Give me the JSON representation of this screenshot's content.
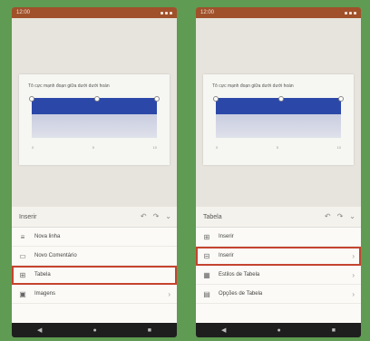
{
  "left_phone": {
    "slide_title": "Tô cực mạnh đoạn giữa dưới dưới hoàn",
    "axis": [
      "0",
      "5",
      "10"
    ],
    "panel_title": "Inserir",
    "menu_items": [
      {
        "label": "Nova linha",
        "icon": "text-icon",
        "chevron": false,
        "highlighted": false
      },
      {
        "label": "Novo Comentário",
        "icon": "comment-icon",
        "chevron": false,
        "highlighted": false
      },
      {
        "label": "Tabela",
        "icon": "table-icon",
        "chevron": false,
        "highlighted": true
      },
      {
        "label": "Imagens",
        "icon": "image-icon",
        "chevron": true,
        "highlighted": false
      }
    ]
  },
  "right_phone": {
    "slide_title": "Tô cực mạnh đoạn giữa dưới dưới hoàn",
    "axis": [
      "0",
      "5",
      "10"
    ],
    "panel_title": "Tabela",
    "menu_items": [
      {
        "label": "Inserir",
        "icon": "table-icon",
        "chevron": false,
        "highlighted": false
      },
      {
        "label": "Inserir",
        "icon": "insert-icon",
        "chevron": true,
        "highlighted": true
      },
      {
        "label": "Estilos de Tabela",
        "icon": "style-icon",
        "chevron": true,
        "highlighted": false
      },
      {
        "label": "Opções de Tabela",
        "icon": "options-icon",
        "chevron": true,
        "highlighted": false
      }
    ]
  },
  "status_time": "12:00",
  "colors": {
    "highlight": "#c5442f",
    "status_bar": "#a0512a",
    "band": "#2b47a8"
  }
}
